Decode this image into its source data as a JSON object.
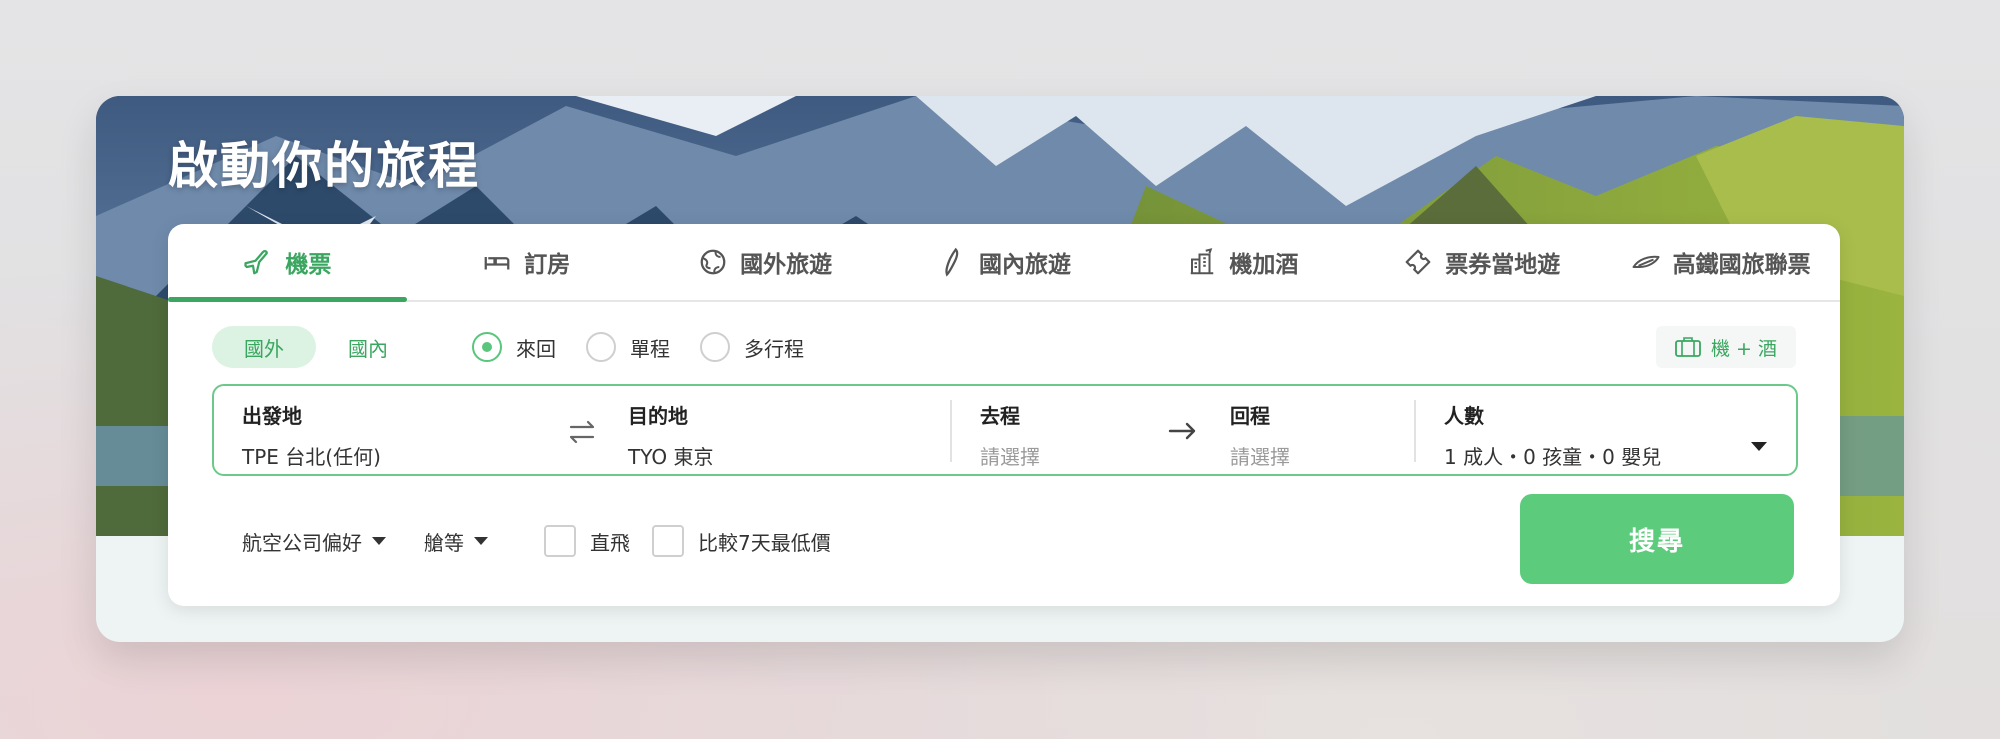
{
  "hero": {
    "title": "啟動你的旅程"
  },
  "tabs": [
    {
      "label": "機票",
      "icon": "airplane-icon",
      "active": true
    },
    {
      "label": "訂房",
      "icon": "bed-icon",
      "active": false
    },
    {
      "label": "國外旅遊",
      "icon": "globe-icon",
      "active": false
    },
    {
      "label": "國內旅遊",
      "icon": "taiwan-island-icon",
      "active": false
    },
    {
      "label": "機加酒",
      "icon": "flight-hotel-icon",
      "active": false
    },
    {
      "label": "票券當地遊",
      "icon": "ticket-icon",
      "active": false
    },
    {
      "label": "高鐵國旅聯票",
      "icon": "high-speed-rail-icon",
      "active": false
    }
  ],
  "region": {
    "international": "國外",
    "domestic": "國內",
    "selected": "國外"
  },
  "trip_type": {
    "options": [
      "來回",
      "單程",
      "多行程"
    ],
    "selected": "來回"
  },
  "combo_button": {
    "label": "機 + 酒",
    "icon": "suitcase-icon"
  },
  "search": {
    "origin": {
      "label": "出發地",
      "value": "TPE 台北(任何)"
    },
    "destination": {
      "label": "目的地",
      "value": "TYO 東京"
    },
    "depart": {
      "label": "去程",
      "placeholder": "請選擇"
    },
    "return": {
      "label": "回程",
      "placeholder": "請選擇"
    },
    "passengers": {
      "label": "人數",
      "value": "1 成人・0 孩童・0 嬰兒"
    }
  },
  "filters": {
    "airline_pref": "航空公司偏好",
    "cabin": "艙等",
    "direct": "直飛",
    "compare_7days": "比較7天最低價"
  },
  "search_button": "搜尋",
  "colors": {
    "accent": "#3aa660",
    "button": "#5ccb7c",
    "border": "#6cc98a"
  }
}
